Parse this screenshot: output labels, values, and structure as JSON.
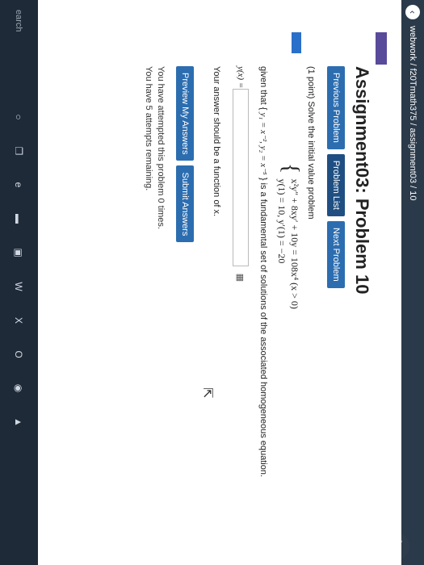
{
  "address": {
    "breadcrumb": "webwork / f20Tmath375 / assignment03 / 10"
  },
  "title": "Assignment03: Problem 10",
  "nav": {
    "previous": "Previous Problem",
    "list": "Problem List",
    "next": "Next Problem"
  },
  "problem": {
    "intro": "(1 point) Solve the initial value problem",
    "eq_line1": "x²y″ + 8xy′ + 10y = 108x⁴   (x > 0)",
    "eq_line2": "y(1) = 10,    y′(1) = −20",
    "given_prefix": "given that {",
    "given_math": "y₁ = x⁻², y₂ = x⁻⁵",
    "given_suffix": "} is a fundamental set of solutions of the associated homogeneous equation.",
    "answer_label": "y(x) =",
    "answer_value": "",
    "hint": "Your answer should be a function of x."
  },
  "actions": {
    "preview": "Preview My Answers",
    "submit": "Submit Answers"
  },
  "attempts": {
    "line1": "You have attempted this problem 0 times.",
    "line2": "You have 5 attempts remaining."
  },
  "taskbar": {
    "search": "earch"
  },
  "colors": {
    "button": "#2c6db0",
    "taskbar": "#1f2a38"
  }
}
